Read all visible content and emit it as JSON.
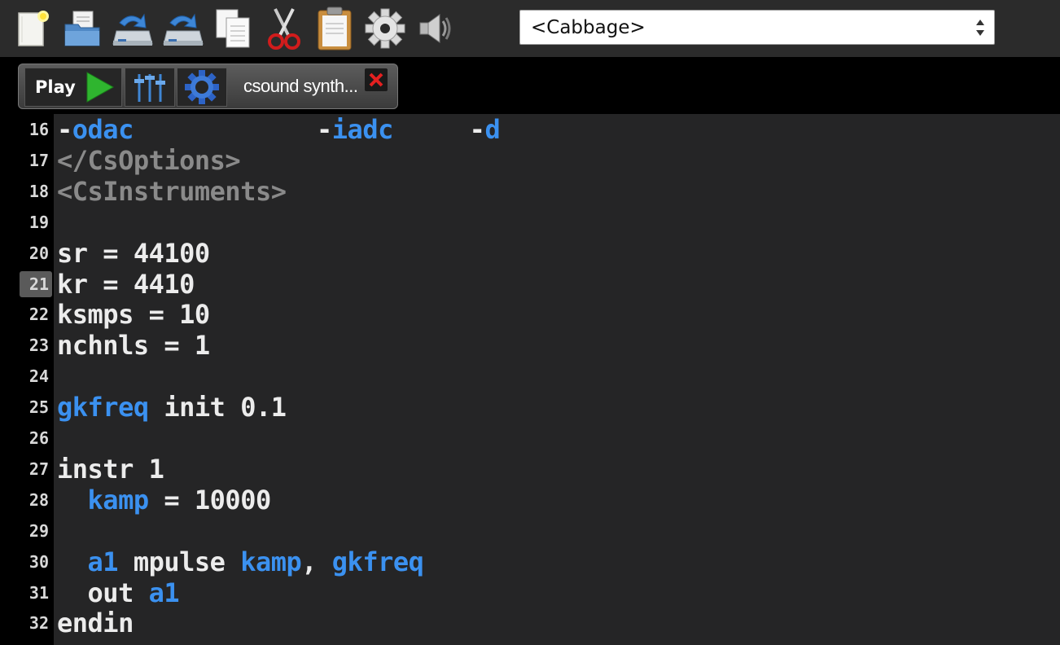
{
  "toolbar": {
    "buttons": [
      {
        "name": "new-file-icon"
      },
      {
        "name": "open-folder-icon"
      },
      {
        "name": "save-icon"
      },
      {
        "name": "save-as-icon"
      },
      {
        "name": "copy-icon"
      },
      {
        "name": "cut-icon"
      },
      {
        "name": "paste-icon"
      },
      {
        "name": "settings-icon"
      },
      {
        "name": "speaker-icon"
      }
    ],
    "target_select": "<Cabbage>"
  },
  "tab": {
    "play_label": "Play",
    "title": "csound synth..."
  },
  "colors": {
    "keyword": "#3b91f0",
    "tag": "#8a8a8a",
    "text": "#ececec",
    "background": "#252526"
  },
  "editor": {
    "current_line": "21",
    "lines": [
      {
        "n": "16",
        "t": [
          "-",
          "odac",
          "            -",
          "iadc",
          "     -",
          "d"
        ]
      },
      {
        "n": "17",
        "t": [
          "</CsOptions>"
        ]
      },
      {
        "n": "18",
        "t": [
          "<CsInstruments>"
        ]
      },
      {
        "n": "19",
        "t": [
          ""
        ]
      },
      {
        "n": "20",
        "t": [
          "sr = 44100"
        ]
      },
      {
        "n": "21",
        "t": [
          "kr = 4410"
        ]
      },
      {
        "n": "22",
        "t": [
          "ksmps = 10"
        ]
      },
      {
        "n": "23",
        "t": [
          "nchnls = 1"
        ]
      },
      {
        "n": "24",
        "t": [
          ""
        ]
      },
      {
        "n": "25",
        "t": [
          "gkfreq",
          " init 0.1"
        ]
      },
      {
        "n": "26",
        "t": [
          ""
        ]
      },
      {
        "n": "27",
        "t": [
          "instr 1"
        ]
      },
      {
        "n": "28",
        "t": [
          "  ",
          "kamp",
          " = 10000"
        ]
      },
      {
        "n": "29",
        "t": [
          ""
        ]
      },
      {
        "n": "30",
        "t": [
          "  ",
          "a1",
          " mpulse ",
          "kamp",
          ", ",
          "gkfreq"
        ]
      },
      {
        "n": "31",
        "t": [
          "  out ",
          "a1"
        ]
      },
      {
        "n": "32",
        "t": [
          "endin"
        ]
      }
    ]
  }
}
